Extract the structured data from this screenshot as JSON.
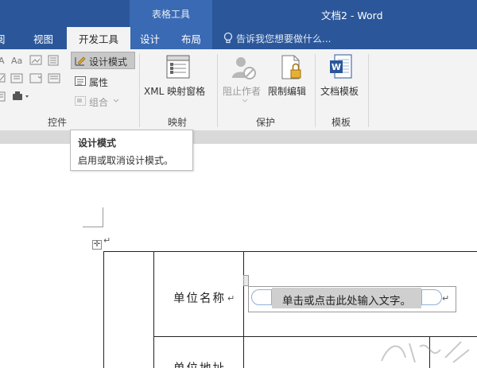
{
  "window": {
    "contextual_tab_group": "表格工具",
    "title": "文档2 - Word"
  },
  "tabs": {
    "review_partial": "阅",
    "view": "视图",
    "developer": "开发工具",
    "design": "设计",
    "layout": "布局"
  },
  "tell_me": {
    "placeholder": "告诉我您想要做什么...",
    "icon": "lightbulb-icon"
  },
  "ribbon": {
    "controls": {
      "design_mode": "设计模式",
      "properties": "属性",
      "group": "组合",
      "label": "控件"
    },
    "mapping": {
      "xml_pane": "XML 映射窗格",
      "label": "映射"
    },
    "protect": {
      "block_authors": "阻止作者",
      "restrict_editing": "限制编辑",
      "label": "保护"
    },
    "templates": {
      "document_template": "文档模板",
      "label": "模板"
    }
  },
  "tooltip": {
    "title": "设计模式",
    "description": "启用或取消设计模式。"
  },
  "document": {
    "table_move_glyph": "✛",
    "row1_label": "单位名称",
    "content_control_placeholder": "单击或点击此处输入文字。",
    "paragraph_mark": "↵",
    "row2_label_partial": "单位地址"
  },
  "colors": {
    "title_bar": "#2b579a",
    "contextual_tab": "#3a6ab3",
    "ribbon_bg": "#f3f3f3",
    "word_icon": "#2b579a"
  }
}
